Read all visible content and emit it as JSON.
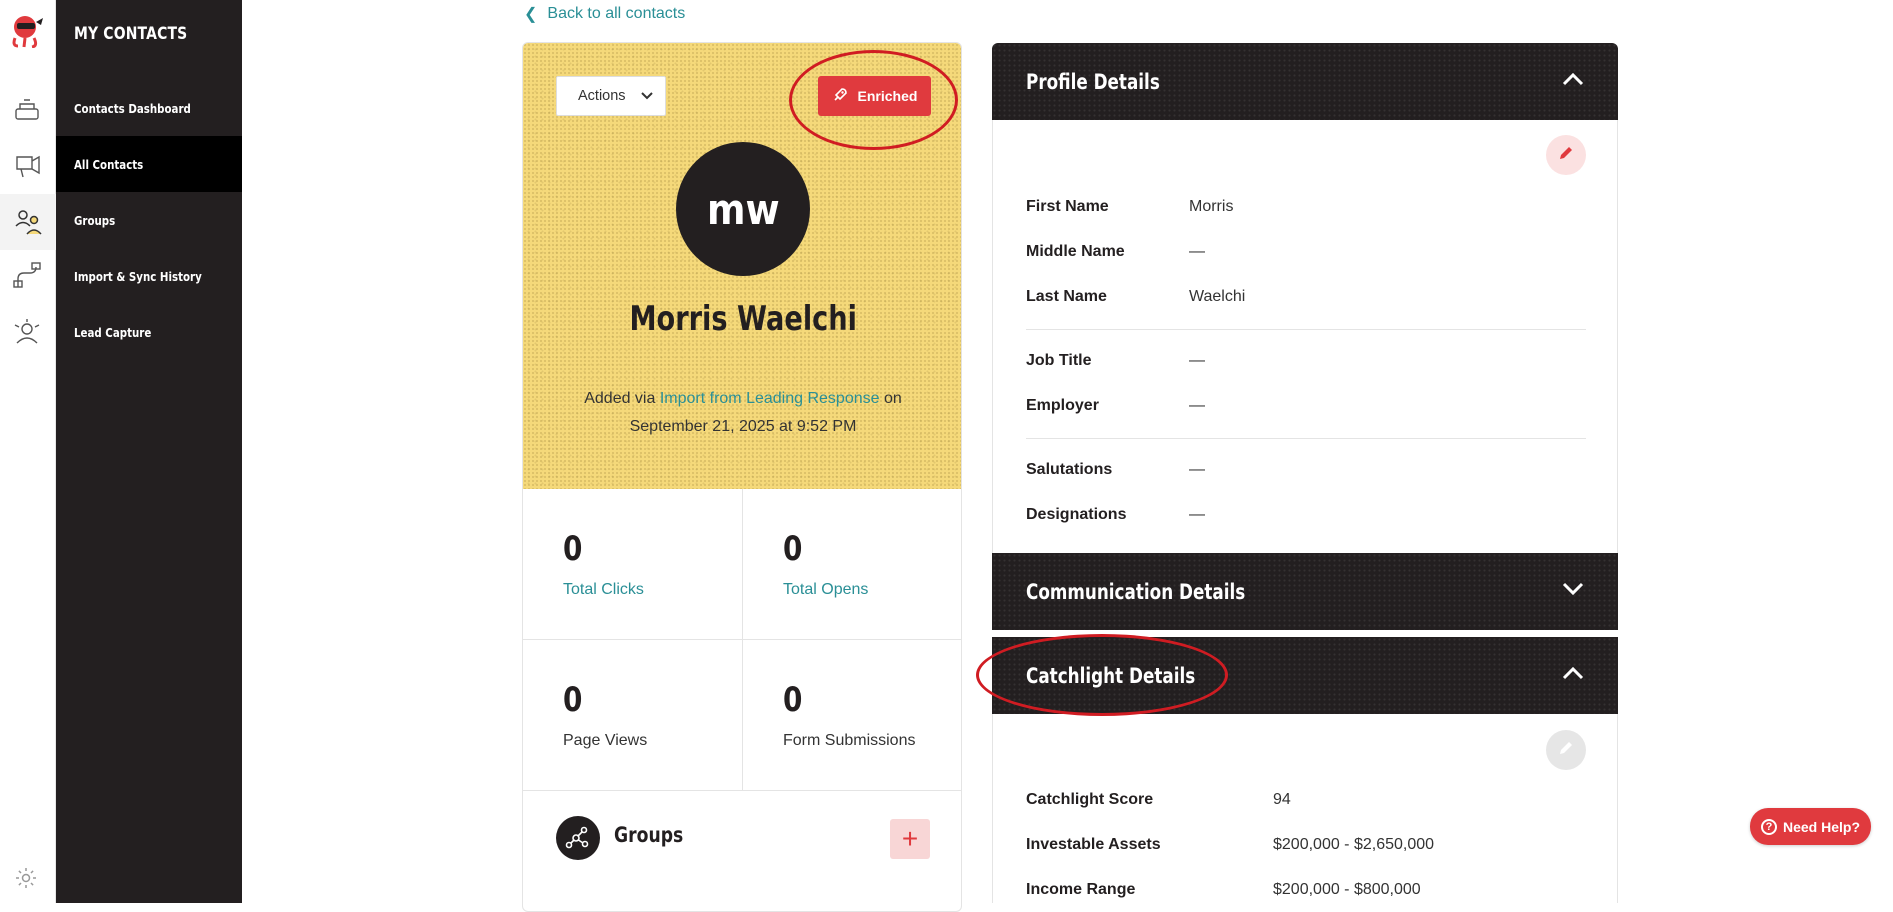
{
  "sidebar": {
    "title": "MY CONTACTS",
    "items": [
      {
        "label": "Contacts Dashboard"
      },
      {
        "label": "All Contacts"
      },
      {
        "label": "Groups"
      },
      {
        "label": "Import & Sync History"
      },
      {
        "label": "Lead Capture"
      }
    ],
    "active_item": "All Contacts"
  },
  "back_link": "Back to all contacts",
  "contact": {
    "initials": "mw",
    "name": "Morris Waelchi",
    "actions_label": "Actions",
    "badge": "Enriched",
    "added_prefix": "Added via",
    "added_source": "Import from Leading Response",
    "added_suffix": "on",
    "added_date": "September 21, 2025 at 9:52 PM"
  },
  "stats": [
    {
      "value": "0",
      "label": "Total Clicks"
    },
    {
      "value": "0",
      "label": "Total Opens"
    },
    {
      "value": "0",
      "label": "Page Views"
    },
    {
      "value": "0",
      "label": "Form Submissions"
    }
  ],
  "groups_section": {
    "title": "Groups",
    "add_label": "+"
  },
  "profile_details": {
    "title": "Profile Details",
    "fields": [
      {
        "key": "First Name",
        "value": "Morris"
      },
      {
        "key": "Middle Name",
        "value": "—"
      },
      {
        "key": "Last Name",
        "value": "Waelchi"
      },
      {
        "key": "Job Title",
        "value": "—"
      },
      {
        "key": "Employer",
        "value": "—"
      },
      {
        "key": "Salutations",
        "value": "—"
      },
      {
        "key": "Designations",
        "value": "—"
      }
    ]
  },
  "communication_details": {
    "title": "Communication Details"
  },
  "catchlight_details": {
    "title": "Catchlight Details",
    "fields": [
      {
        "key": "Catchlight Score",
        "value": "94"
      },
      {
        "key": "Investable Assets",
        "value": "$200,000 - $2,650,000"
      },
      {
        "key": "Income Range",
        "value": "$200,000 - $800,000"
      }
    ]
  },
  "help_button": "Need Help?",
  "colors": {
    "accent_red": "#e03a3e",
    "teal_link": "#2a8f96",
    "dark": "#231f20",
    "hero_yellow": "#f5d97a"
  }
}
